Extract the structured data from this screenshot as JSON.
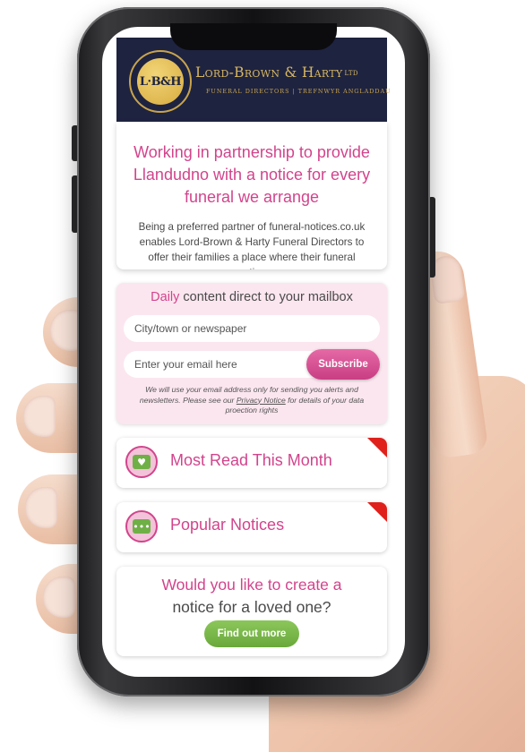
{
  "header": {
    "logo_text": "L·B&H",
    "brand_name": "Lord-Brown & Harty",
    "brand_suffix": "LTD",
    "tagline": "FUNERAL DIRECTORS | TREFNWYR ANGLADDAU"
  },
  "partnership": {
    "title": "Working in partnership to provide Llandudno with a notice for every funeral we arrange",
    "body": "Being a preferred partner of funeral-notices.co.uk enables Lord-Brown & Harty Funeral Directors to offer their families a place where their funeral notice"
  },
  "newsletter": {
    "heading_accent": "Daily",
    "heading_rest": " content direct to your mailbox",
    "city_placeholder": "City/town or newspaper",
    "email_placeholder": "Enter your email here",
    "subscribe_label": "Subscribe",
    "note_before": "We will use your email address only for sending you alerts and newsletters. Please see our ",
    "note_link": "Privacy Notice",
    "note_after": " for details of your data proection rights"
  },
  "cards": {
    "most_read": "Most Read This Month",
    "popular": "Popular Notices"
  },
  "create": {
    "line1": "Would you like to create a",
    "line2": "notice for a loved one?",
    "button": "Find out more"
  },
  "colors": {
    "accent_pink": "#d2448c",
    "header_navy": "#1e2340",
    "gold": "#c9a44c",
    "cta_green": "#6aa83b",
    "flag_red": "#e0201b"
  },
  "icons": {
    "most_read": "laptop-heart-icon",
    "popular": "people-chat-icon"
  }
}
